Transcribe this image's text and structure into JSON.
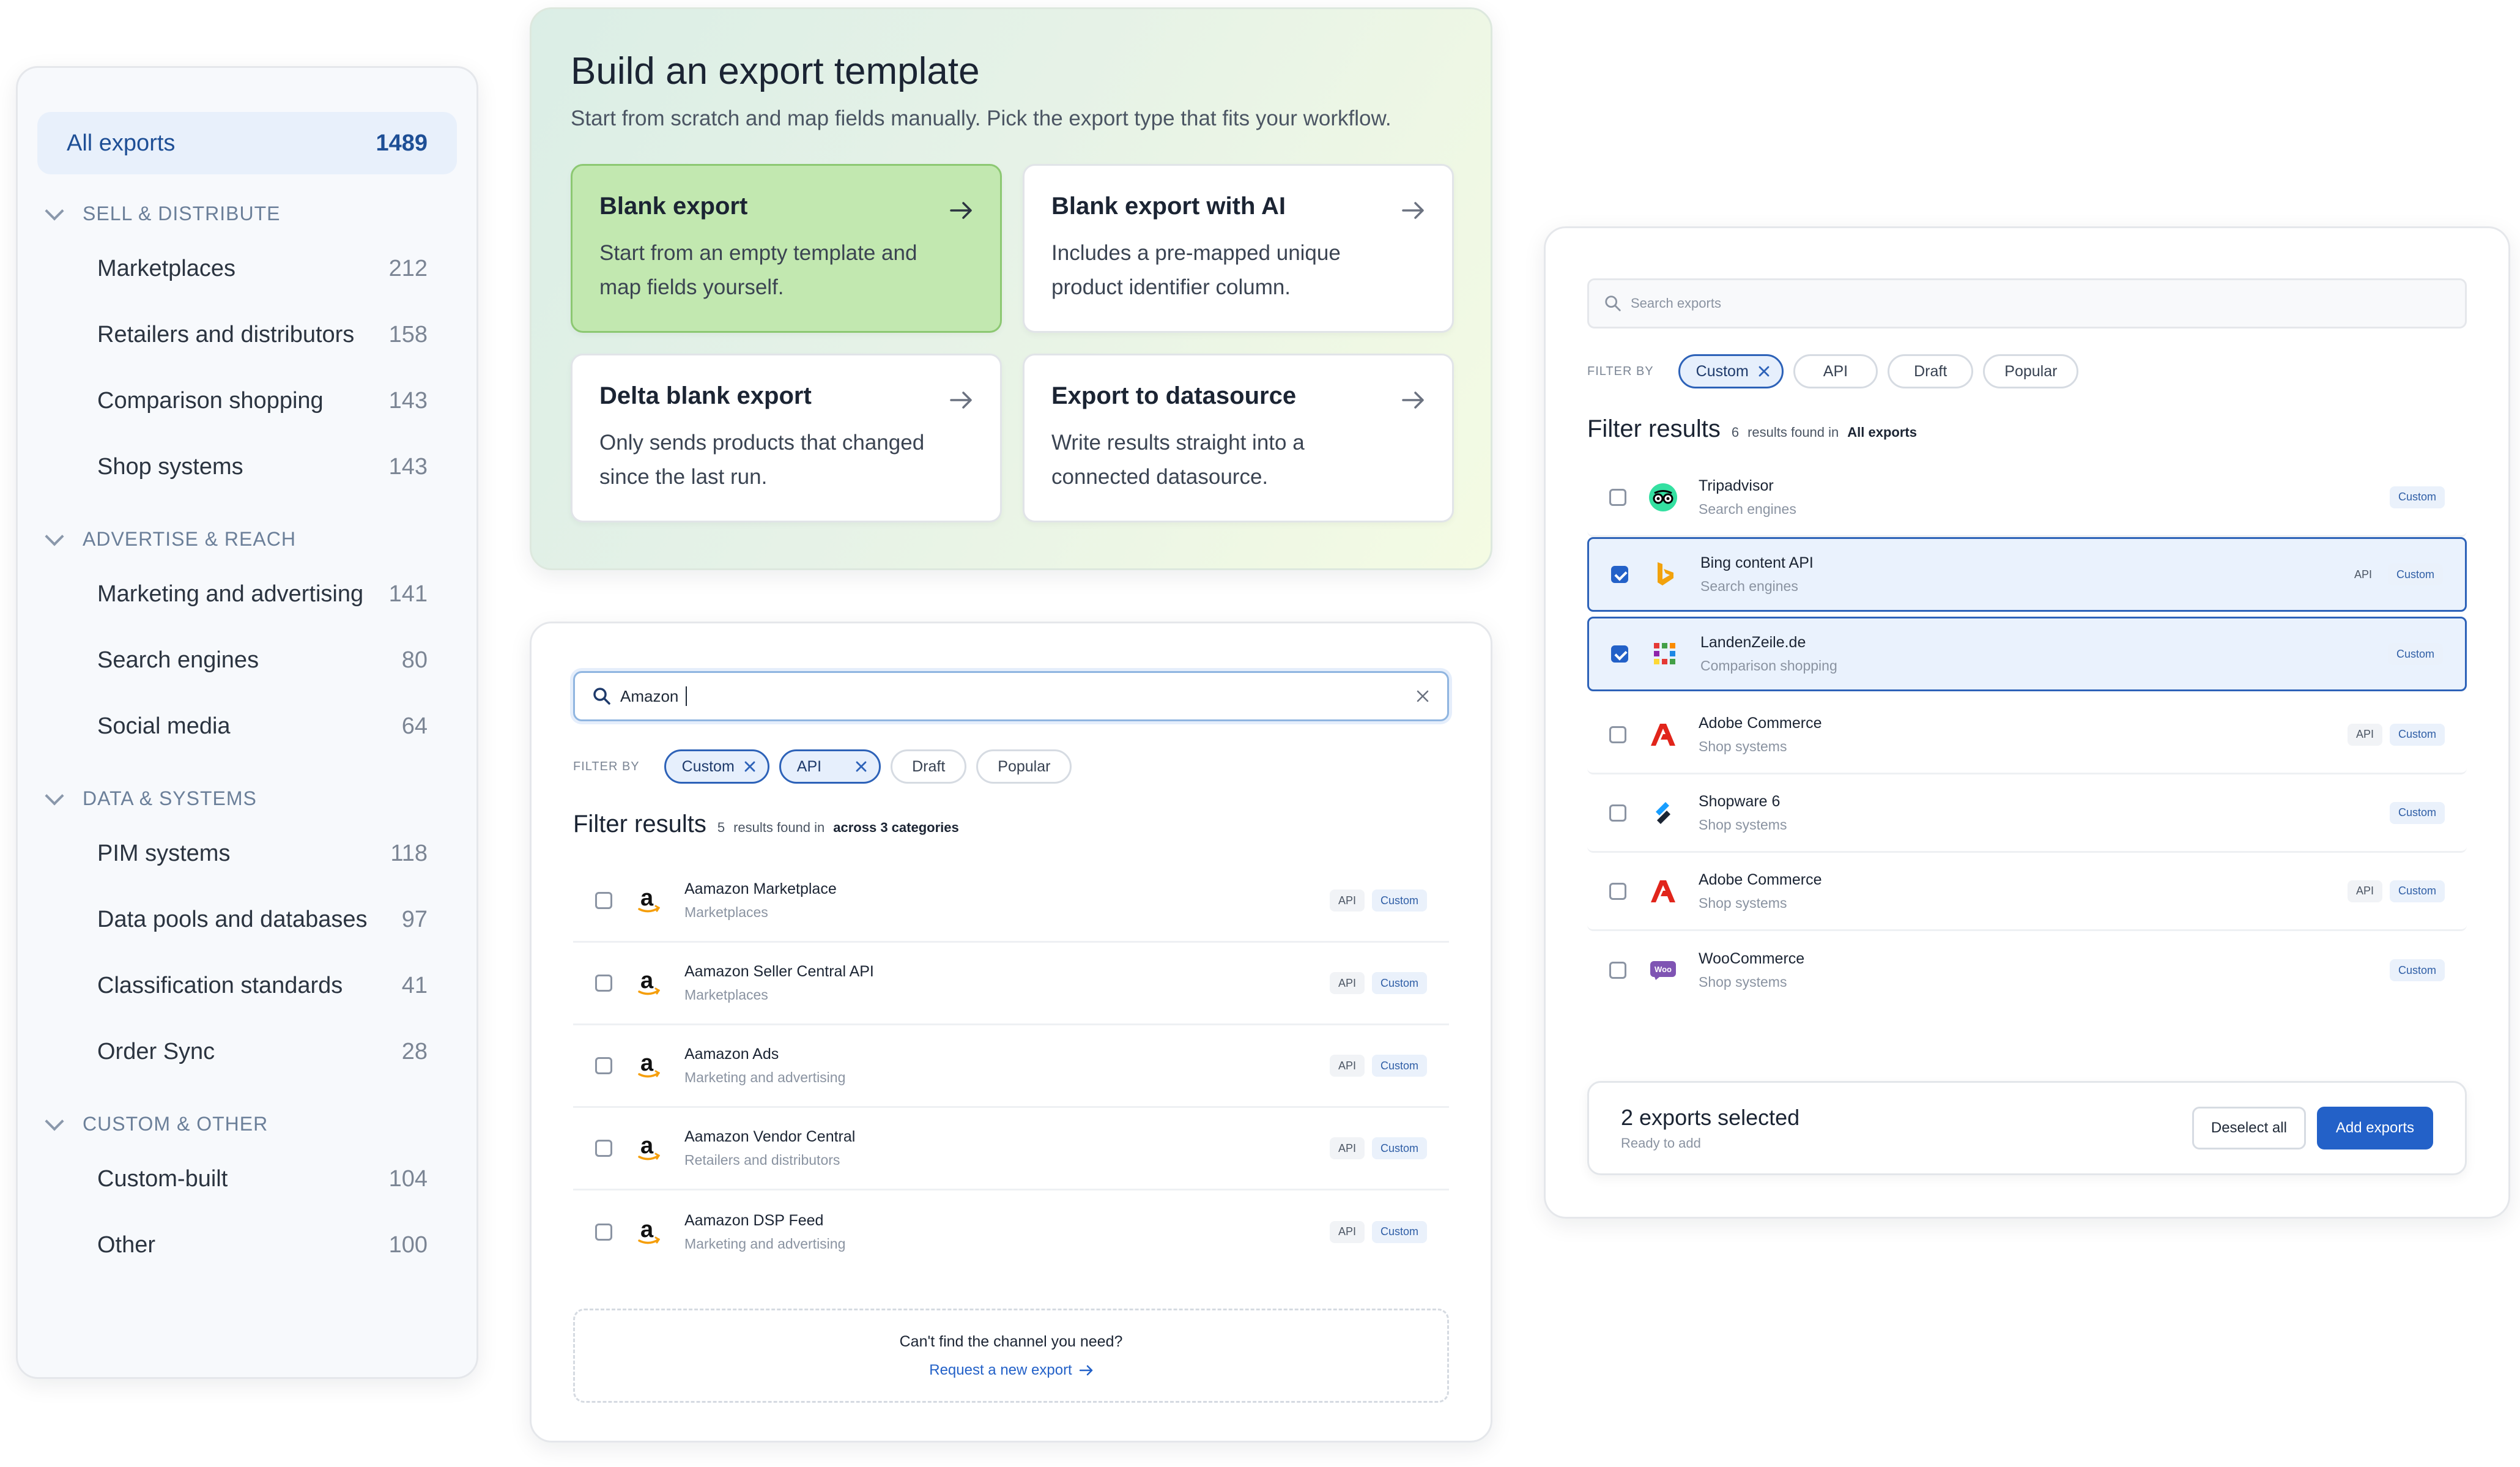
{
  "sidebar": {
    "all": {
      "label": "All exports",
      "count": "1489"
    },
    "groups": [
      {
        "title": "SELL & DISTRIBUTE",
        "items": [
          {
            "label": "Marketplaces",
            "count": "212"
          },
          {
            "label": "Retailers and distributors",
            "count": "158"
          },
          {
            "label": "Comparison shopping",
            "count": "143"
          },
          {
            "label": "Shop systems",
            "count": "143"
          }
        ]
      },
      {
        "title": "ADVERTISE & REACH",
        "items": [
          {
            "label": "Marketing and advertising",
            "count": "141"
          },
          {
            "label": "Search engines",
            "count": "80"
          },
          {
            "label": "Social media",
            "count": "64"
          }
        ]
      },
      {
        "title": "DATA & SYSTEMS",
        "items": [
          {
            "label": "PIM systems",
            "count": "118"
          },
          {
            "label": "Data pools and databases",
            "count": "97"
          },
          {
            "label": "Classification standards",
            "count": "41"
          },
          {
            "label": "Order Sync",
            "count": "28"
          }
        ]
      },
      {
        "title": "CUSTOM & OTHER",
        "items": [
          {
            "label": "Custom-built",
            "count": "104"
          },
          {
            "label": "Other",
            "count": "100"
          }
        ]
      }
    ]
  },
  "template": {
    "title": "Build an export template",
    "subtitle": "Start from scratch and map fields manually. Pick the export type that fits your workflow.",
    "cards": [
      {
        "title": "Blank export",
        "desc": "Start from an empty template and map fields yourself."
      },
      {
        "title": "Blank export with AI",
        "desc": "Includes a pre-mapped unique product identifier column."
      },
      {
        "title": "Delta blank export",
        "desc": "Only sends products that changed since the last run."
      },
      {
        "title": "Export to datasource",
        "desc": "Write results straight into a connected datasource."
      }
    ]
  },
  "search_panel": {
    "query": "Amazon",
    "filter_label": "FILTER BY",
    "chips": [
      "Custom",
      "API",
      "Draft",
      "Popular"
    ],
    "results_title": "Filter results",
    "results_count": "5",
    "results_found_in": "results found in",
    "results_scope": "across 3 categories",
    "rows": [
      {
        "name": "Aamazon Marketplace",
        "category": "Marketplaces"
      },
      {
        "name": "Aamazon Seller Central API",
        "category": "Marketplaces"
      },
      {
        "name": "Aamazon Ads",
        "category": "Marketing and advertising"
      },
      {
        "name": "Aamazon Vendor Central",
        "category": "Retailers and distributors"
      },
      {
        "name": "Aamazon DSP Feed",
        "category": "Marketing and advertising"
      }
    ],
    "tag_api": "API",
    "tag_custom": "Custom",
    "request_question": "Can't find the channel you need?",
    "request_link": "Request a new export"
  },
  "right_panel": {
    "search_placeholder": "Search exports",
    "filter_label": "FILTER BY",
    "chips": [
      "Custom",
      "API",
      "Draft",
      "Popular"
    ],
    "results_title": "Filter results",
    "results_count": "6",
    "results_found_in": "results found in",
    "results_scope": "All exports",
    "rows": [
      {
        "name": "Tripadvisor",
        "category": "Search engines"
      },
      {
        "name": "Bing content API",
        "category": "Search engines"
      },
      {
        "name": "LandenZeile.de",
        "category": "Comparison shopping"
      },
      {
        "name": "Adobe Commerce",
        "category": "Shop systems"
      },
      {
        "name": "Shopware 6",
        "category": "Shop systems"
      },
      {
        "name": "Adobe Commerce",
        "category": "Shop systems"
      },
      {
        "name": "WooCommerce",
        "category": "Shop systems"
      }
    ],
    "tag_api": "API",
    "tag_custom": "Custom",
    "selection_title": "2 exports selected",
    "selection_sub": "Ready to add",
    "deselect_label": "Deselect all",
    "add_label": "Add exports",
    "woo_logo_text": "Woo"
  },
  "colors": {
    "accent": "#2361c8",
    "active_card": "#c2e8b0",
    "custom_tag": "#eaf1fb"
  }
}
